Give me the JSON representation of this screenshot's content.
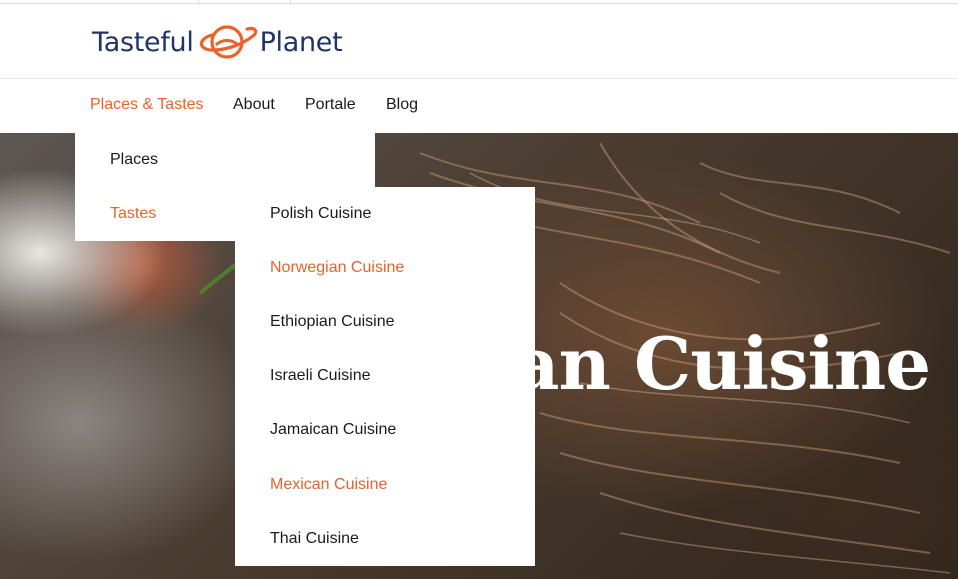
{
  "logo": {
    "word_left": "Tasteful",
    "word_right": "Planet",
    "text_color": "#1f3566",
    "icon_color": "#e8622a",
    "icon": "planet-icon"
  },
  "nav": {
    "items": [
      {
        "label": "Places & Tastes",
        "active": true
      },
      {
        "label": "About",
        "active": false
      },
      {
        "label": "Portale",
        "active": false
      },
      {
        "label": "Blog",
        "active": false
      }
    ]
  },
  "dropdown": {
    "items": [
      {
        "label": "Places",
        "active": false
      },
      {
        "label": "Tastes",
        "active": true
      }
    ]
  },
  "submenu": {
    "items": [
      {
        "label": "Polish Cuisine",
        "active": false
      },
      {
        "label": "Norwegian Cuisine",
        "active": true
      },
      {
        "label": "Ethiopian Cuisine",
        "active": false
      },
      {
        "label": "Israeli Cuisine",
        "active": false
      },
      {
        "label": "Jamaican Cuisine",
        "active": false
      },
      {
        "label": "Mexican Cuisine",
        "active": true
      },
      {
        "label": "Thai Cuisine",
        "active": false
      }
    ]
  },
  "hero": {
    "title_visible": "can Cuisine"
  },
  "colors": {
    "accent": "#e8622a",
    "text": "#1a1a1a",
    "background": "#ffffff"
  }
}
